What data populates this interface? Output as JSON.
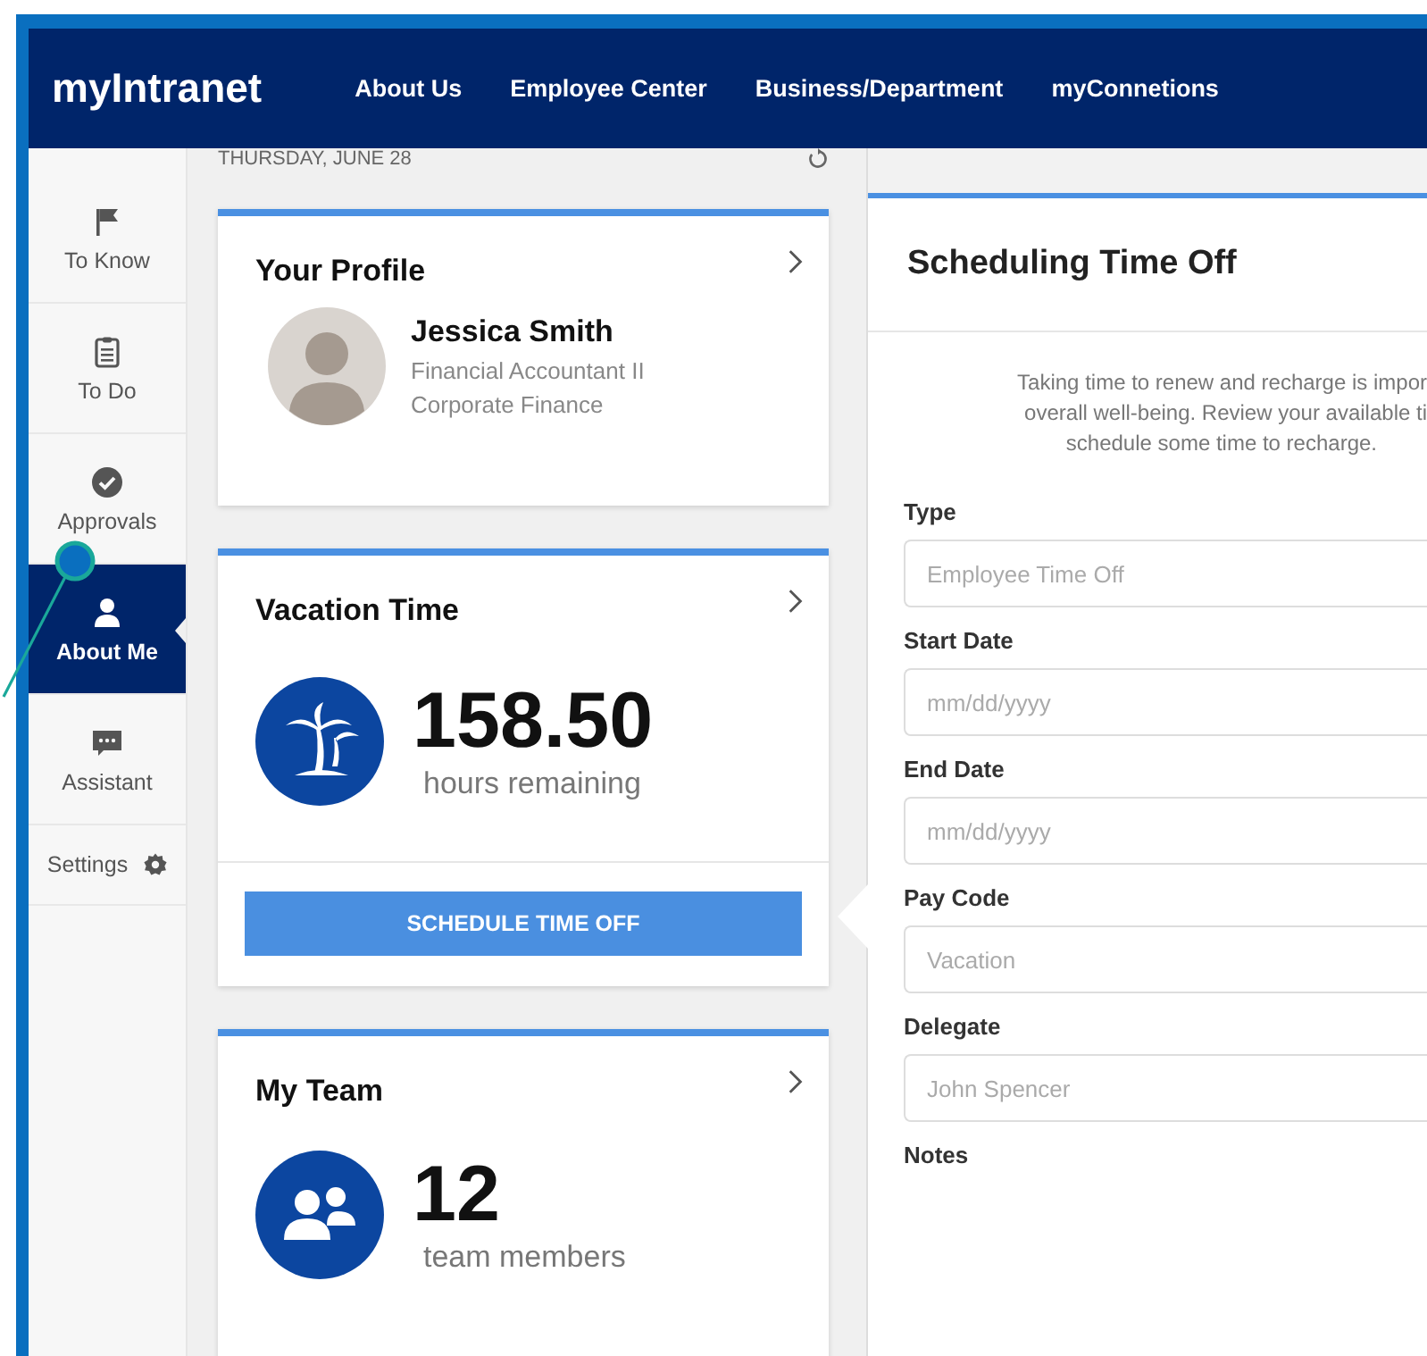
{
  "header": {
    "logo": "myIntranet",
    "nav": [
      "About Us",
      "Employee Center",
      "Business/Department",
      "myConnetions"
    ]
  },
  "sidebar": {
    "items": [
      {
        "label": "To Know",
        "selected": false
      },
      {
        "label": "To Do",
        "selected": false
      },
      {
        "label": "Approvals",
        "selected": false
      },
      {
        "label": "About Me",
        "selected": true
      },
      {
        "label": "Assistant",
        "selected": false
      }
    ],
    "settings": "Settings"
  },
  "date": "THURSDAY, JUNE 28",
  "profile": {
    "title": "Your Profile",
    "name": "Jessica Smith",
    "role": "Financial Accountant II",
    "department": "Corporate Finance"
  },
  "vacation": {
    "title": "Vacation Time",
    "hours": "158.50",
    "caption": "hours remaining",
    "button": "SCHEDULE TIME OFF"
  },
  "team": {
    "title": "My Team",
    "count": "12",
    "caption": "team members"
  },
  "panel": {
    "title": "Scheduling Time Off",
    "intro": [
      "Taking time to renew and recharge is impor",
      "overall well-being. Review your available ti",
      "schedule some time to recharge."
    ],
    "fields": [
      {
        "label": "Type",
        "placeholder": "Employee Time Off"
      },
      {
        "label": "Start Date",
        "placeholder": "mm/dd/yyyy"
      },
      {
        "label": "End Date",
        "placeholder": "mm/dd/yyyy"
      },
      {
        "label": "Pay Code",
        "placeholder": "Vacation"
      },
      {
        "label": "Delegate",
        "placeholder": "John Spencer"
      },
      {
        "label": "Notes"
      }
    ]
  }
}
